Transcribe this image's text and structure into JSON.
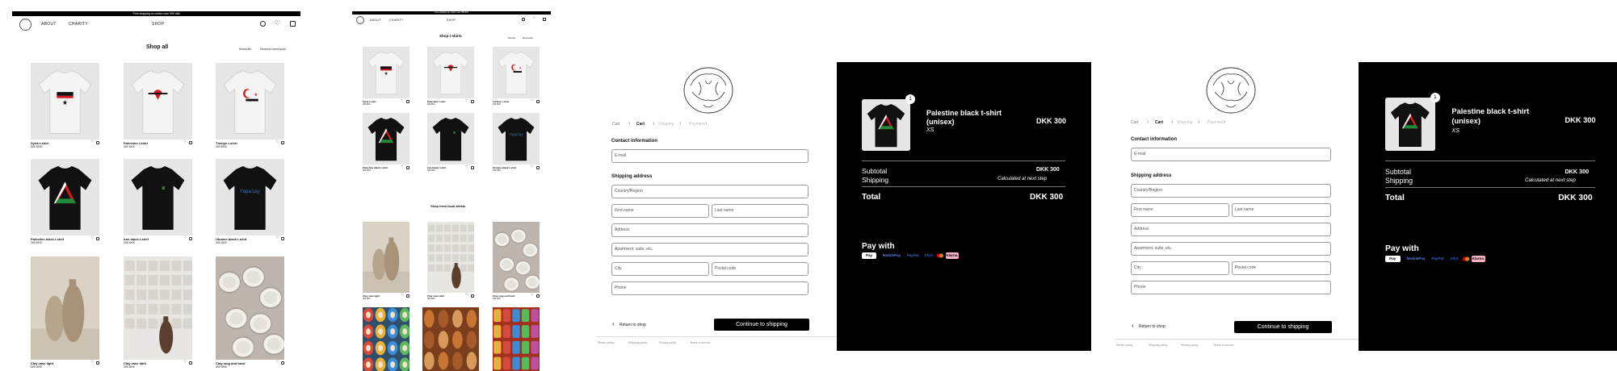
{
  "shop_all": {
    "banner": "Free shipping on orders over 300 dkk",
    "nav": {
      "about": "ABOUT",
      "charity": "CHARITY",
      "shop": "SHOP"
    },
    "title": "Shop all",
    "sort": {
      "a": "Bestseller",
      "b": "Newest/Lowest/price"
    },
    "products": [
      {
        "name": "Syria t-shirt",
        "price": "300 DKK"
      },
      {
        "name": "Palestine t-shirt",
        "price": "300 DKK"
      },
      {
        "name": "Türkiye t-shirt",
        "price": "300 DKK"
      },
      {
        "name": "Palestine black t-shirt",
        "price": "300 DKK"
      },
      {
        "name": "Iran black t-shirt",
        "price": "300 DKK"
      },
      {
        "name": "Ukraine black t-shirt",
        "price": "300 DKK"
      },
      {
        "name": "Clay vase light",
        "price": "300 DKK"
      },
      {
        "name": "Clay vase dark",
        "price": "300 DKK"
      },
      {
        "name": "Clay mug and bowl",
        "price": "300 DKK"
      }
    ]
  },
  "shop_tshirts": {
    "banner": "Free shipping on orders over 300 dkk",
    "nav": {
      "about": "ABOUT",
      "charity": "CHARITY",
      "shop": "SHOP"
    },
    "title": "Shop t-shirts",
    "sort": {
      "a": "Bundle",
      "b": "Bestseller"
    },
    "local_title": "Shop from local artists",
    "products": [
      {
        "name": "Syria t-shirt",
        "price": "300 DKK"
      },
      {
        "name": "Palestine t-shirt",
        "price": "300 DKK"
      },
      {
        "name": "Türkiye t-shirt",
        "price": "300 DKK"
      },
      {
        "name": "Palestine black t-shirt",
        "price": "300 DKK"
      },
      {
        "name": "Iran black t-shirt",
        "price": "300 DKK"
      },
      {
        "name": "Ukraine black t-shirt",
        "price": "300 DKK"
      },
      {
        "name": "Clay vase light",
        "price": "300 DKK"
      },
      {
        "name": "Clay vase dark",
        "price": "300 DKK"
      },
      {
        "name": "Clay mug and bowl",
        "price": "300 DKK"
      }
    ]
  },
  "checkout": {
    "breadcrumb": [
      "Cart",
      "Cart",
      "Shipping",
      "Payment"
    ],
    "contact_title": "Contact information",
    "email_placeholder": "E-mail",
    "shipping_title": "Shipping address",
    "country_placeholder": "Country/Region",
    "first_name_placeholder": "First name",
    "last_name_placeholder": "Last name",
    "address_placeholder": "Address",
    "apartment_placeholder": "Apartment, suite, etc.",
    "city_placeholder": "City",
    "postal_placeholder": "Postal code",
    "phone_placeholder": "Phone",
    "return_label": "Return to shop",
    "continue_label": "Continue to shipping",
    "footer_links": [
      "Return policy",
      "Shipping policy",
      "Privacy policy",
      "Terms of service"
    ]
  },
  "summary": {
    "item_name_line1": "Palestine black t-shirt",
    "item_name_line2": "(unisex)",
    "item_variant": "XS",
    "item_qty": "1",
    "item_price": "DKK 300",
    "subtotal_label": "Subtotal",
    "subtotal_value": "DKK 300",
    "shipping_label": "Shipping",
    "shipping_value": "Calculated at next step",
    "total_label": "Total",
    "total_value": "DKK 300",
    "pay_with": "Pay with",
    "methods": [
      "Pay",
      "MobilePay",
      "PayPal",
      "VISA",
      "Mastercard",
      "Klarna."
    ]
  },
  "colors": {
    "black": "#000000",
    "red": "#d01c1f",
    "green": "#1f8a3c",
    "klarna": "#ffb3c7"
  }
}
